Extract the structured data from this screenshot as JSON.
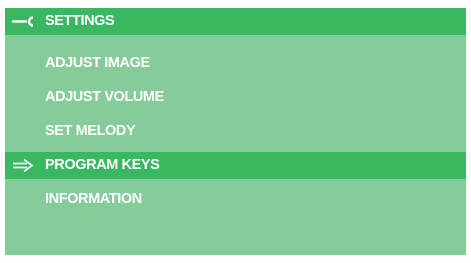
{
  "colors": {
    "background": "#86cb9a",
    "highlight": "#3ab761",
    "text": "#ffffff"
  },
  "header": {
    "icon": "wrench-icon",
    "title": "SETTINGS"
  },
  "menu": {
    "selected_index": 3,
    "selector_icon": "right-arrow-icon",
    "items": [
      {
        "label": "ADJUST IMAGE"
      },
      {
        "label": "ADJUST VOLUME"
      },
      {
        "label": "SET MELODY"
      },
      {
        "label": "PROGRAM KEYS"
      },
      {
        "label": "INFORMATION"
      }
    ]
  }
}
